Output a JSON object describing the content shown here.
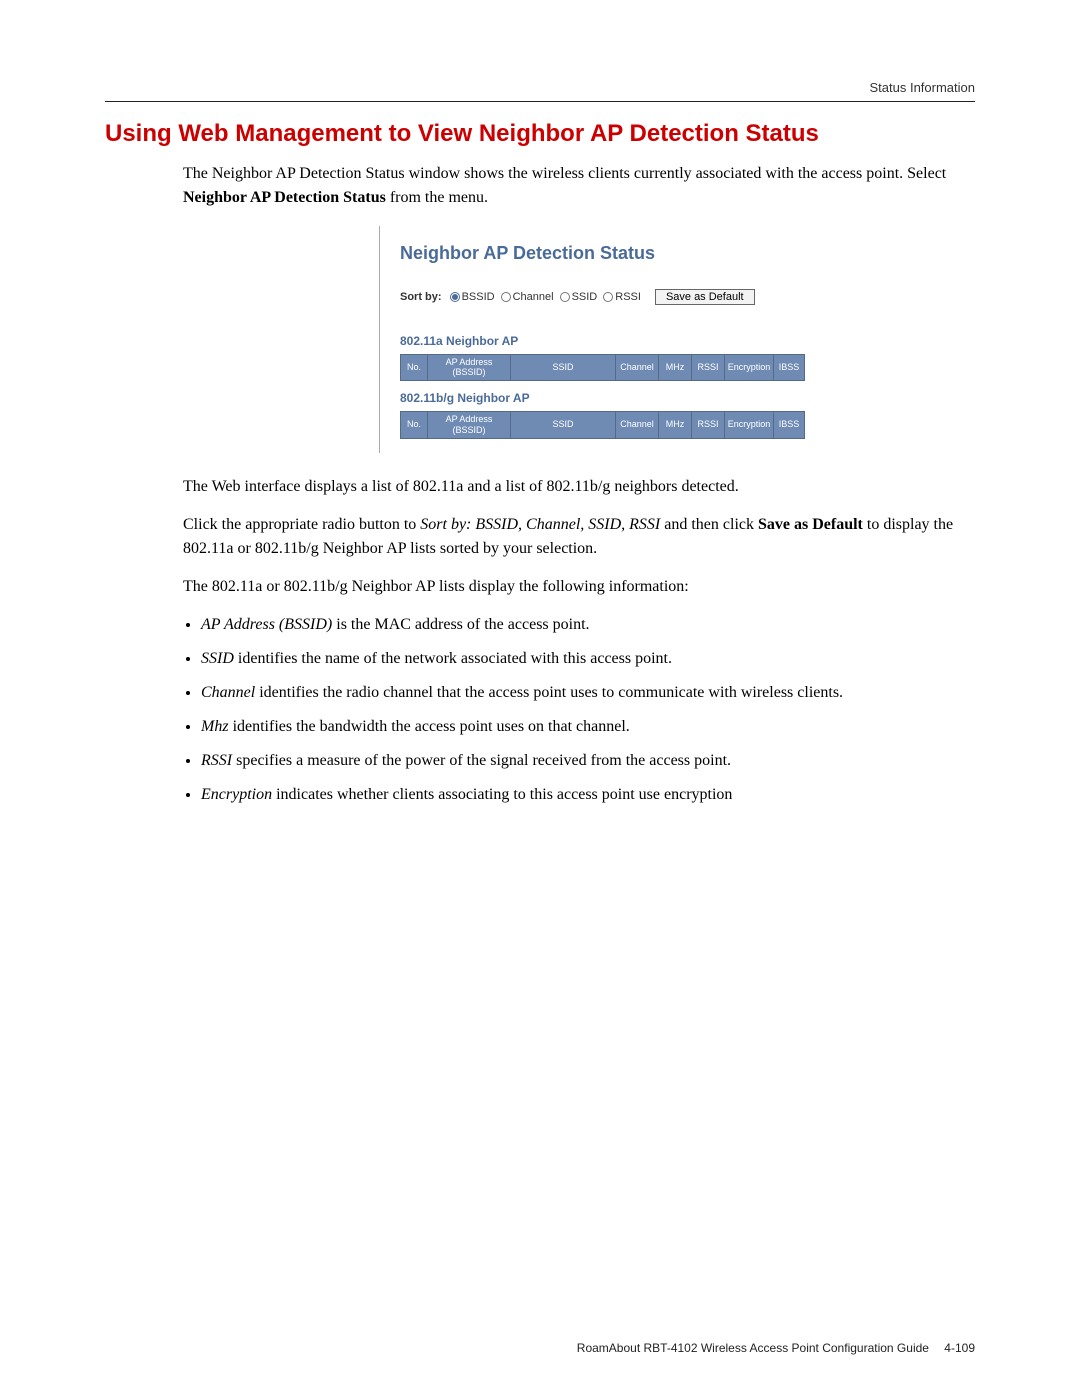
{
  "header": {
    "section_label": "Status Information"
  },
  "title": "Using Web Management to View Neighbor AP Detection Status",
  "intro": {
    "p1a": "The Neighbor AP Detection Status window shows the wireless clients currently associated with the access point. Select ",
    "p1b_bold": "Neighbor AP Detection Status",
    "p1c": " from the menu."
  },
  "ui": {
    "title": "Neighbor AP Detection Status",
    "sort_label": "Sort by:",
    "sort_options": [
      "BSSID",
      "Channel",
      "SSID",
      "RSSI"
    ],
    "sort_selected": "BSSID",
    "save_button": "Save as Default",
    "section_a": "802.11a Neighbor AP",
    "section_bg": "802.11b/g Neighbor AP",
    "columns": {
      "no": "No.",
      "addr_l1": "AP Address",
      "addr_l2": "(BSSID)",
      "ssid": "SSID",
      "channel": "Channel",
      "mhz": "MHz",
      "rssi": "RSSI",
      "encryption": "Encryption",
      "ibss": "IBSS"
    }
  },
  "after": {
    "p2": "The Web interface displays a list of 802.11a and a list of 802.11b/g neighbors detected.",
    "p3a": "Click the appropriate radio button to ",
    "p3b_i": "Sort by: BSSID, Channel, SSID, RSSI",
    "p3c": " and then click ",
    "p3d_b": "Save as Default",
    "p3e": " to display the 802.11a or 802.11b/g Neighbor AP lists sorted by your selection.",
    "p4": "The 802.11a or 802.11b/g Neighbor AP lists display the following information:"
  },
  "bullets": [
    {
      "term": "AP Address (BSSID)",
      "rest": " is the MAC address of the access point."
    },
    {
      "term": "SSID",
      "rest": " identifies the name of the network associated with this access point."
    },
    {
      "term": "Channel",
      "rest": " identifies the radio channel that the access point uses to communicate with wireless clients."
    },
    {
      "term": "Mhz",
      "rest": " identifies the bandwidth the access point uses on that channel."
    },
    {
      "term": "RSSI",
      "rest": " specifies a measure of the power of the signal received from the access point."
    },
    {
      "term": "Encryption",
      "rest": " indicates whether clients associating to this access point use encryption"
    }
  ],
  "footer": {
    "doc": "RoamAbout RBT-4102 Wireless Access Point Configuration Guide",
    "page": "4-109"
  }
}
